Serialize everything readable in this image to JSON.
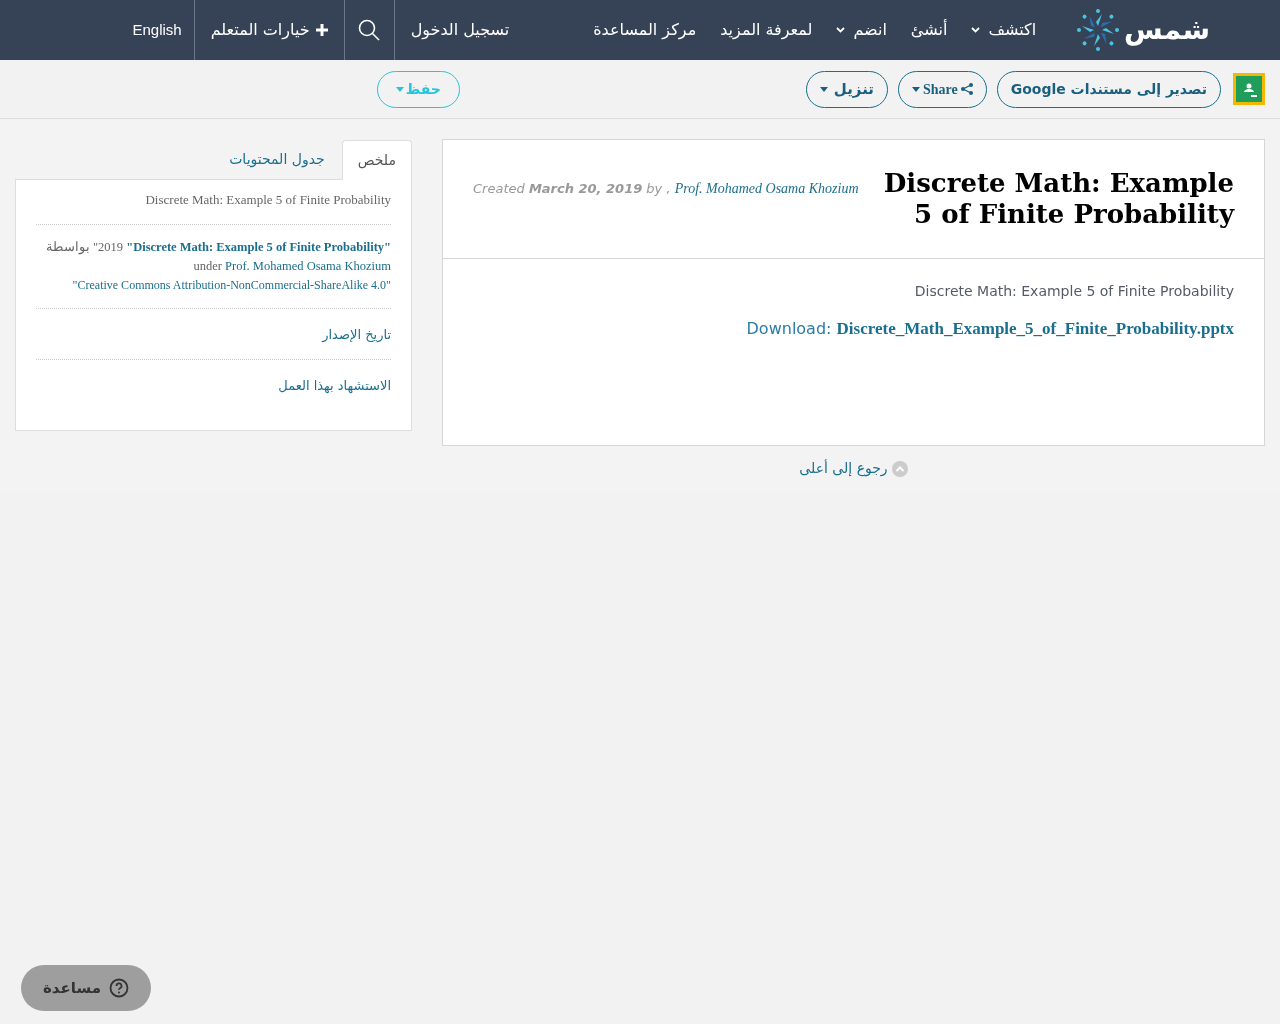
{
  "nav": {
    "logo": "شمس",
    "items": [
      {
        "label": "اكتشف",
        "dropdown": true
      },
      {
        "label": "أنشئ",
        "dropdown": false
      },
      {
        "label": "انضم",
        "dropdown": true
      },
      {
        "label": "لمعرفة المزيد",
        "dropdown": false
      },
      {
        "label": "مركز المساعدة",
        "dropdown": false
      }
    ],
    "login": "تسجيل الدخول",
    "learner_options": "خيارات المتعلم",
    "language": "English"
  },
  "toolbar": {
    "buttons": [
      {
        "label": "تصدير إلى مستندات Google",
        "kind": "export"
      },
      {
        "label": "Share",
        "kind": "share"
      },
      {
        "label": "تنزيل",
        "kind": "download"
      },
      {
        "label": "حفظ",
        "kind": "save"
      }
    ]
  },
  "resource": {
    "title": "Discrete Math: Example 5 of Finite Probability",
    "created": "Created **March 20, 2019** by ,",
    "author": "Prof. Mohamed Osama Khozium",
    "description": "Discrete Math: Example 5 of Finite Probability",
    "download_label": "Download:",
    "download_file": "Discrete_Math_Example_5_of_Finite_Probability.pptx"
  },
  "back_to_top": "رجوع إلى أعلى",
  "sidebar": {
    "tabs": [
      {
        "label": "ملخص",
        "selected": true
      },
      {
        "label": "جدول المحتويات",
        "selected": false
      }
    ],
    "summary": "Discrete Math: Example 5 of Finite Probability",
    "attribution": {
      "title": "\"Discrete Math: Example 5 of Finite Probability\"",
      "year": "2019\"",
      "by": "بواسطة",
      "author": "Prof. Mohamed Osama Khozium",
      "under": "under",
      "license": "\"Creative Commons Attribution-NonCommercial-ShareAlike 4.0\""
    },
    "links": [
      "تاريخ الإصدار",
      "الاستشهاد بهذا العمل"
    ]
  },
  "help_button": "مساعدة"
}
